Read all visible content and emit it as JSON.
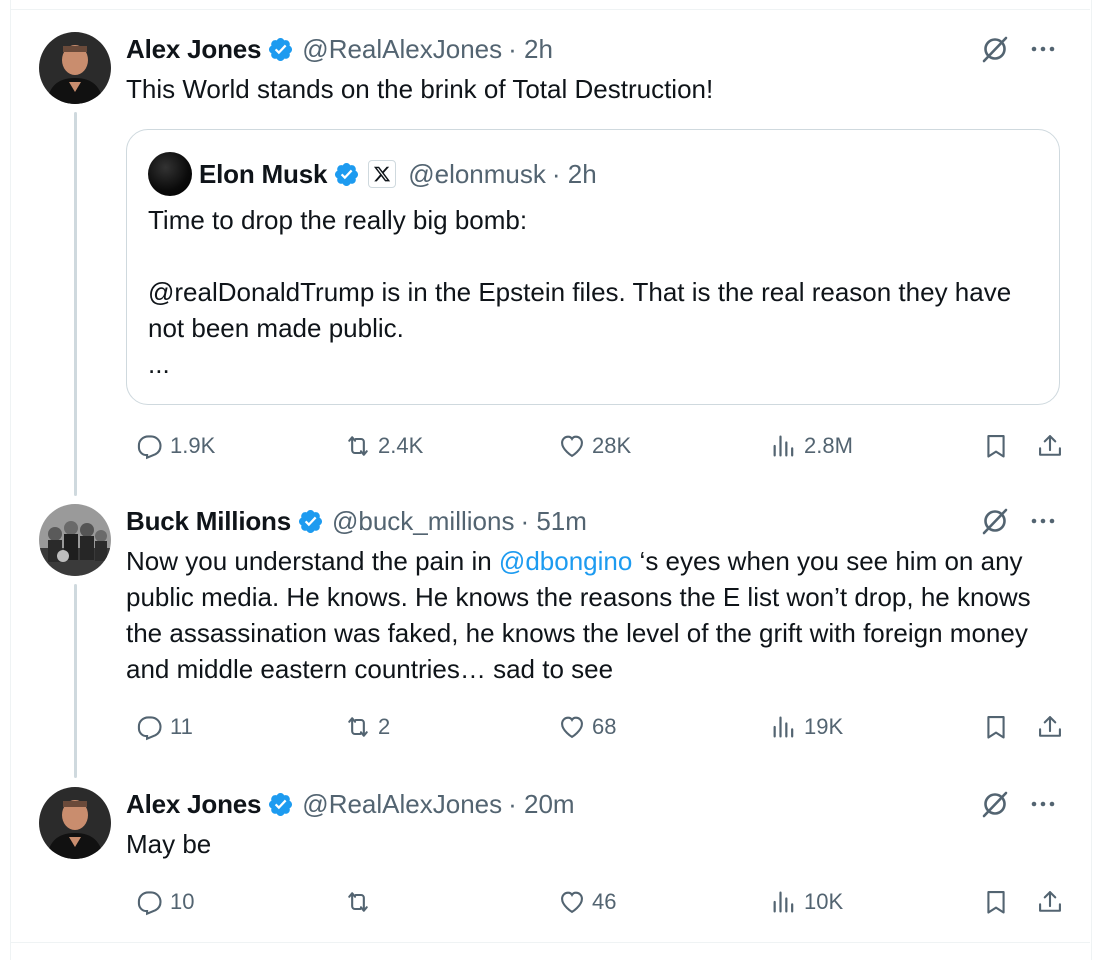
{
  "tweets": [
    {
      "name": "Alex Jones",
      "handle": "@RealAlexJones",
      "time": "· 2h",
      "text": "This World stands on the brink of Total Destruction!",
      "quote": {
        "name": "Elon Musk",
        "handle": "@elonmusk",
        "time": "· 2h",
        "line1": "Time to drop the really big bomb:",
        "line2": "@realDonaldTrump is in the Epstein files. That is the real reason they have not been made public.",
        "line3": "..."
      },
      "replies": "1.9K",
      "reposts": "2.4K",
      "likes": "28K",
      "views": "2.8M"
    },
    {
      "name": "Buck Millions",
      "handle": "@buck_millions",
      "time": "· 51m",
      "text_before": "Now you understand the pain in ",
      "mention": "@dbongino",
      "text_after": " ‘s eyes when you see him on any public media. He knows. He knows the reasons the E list won’t drop, he knows the assassination was faked, he knows the level of the grift with foreign money and middle eastern countries… sad to see",
      "replies": "11",
      "reposts": "2",
      "likes": "68",
      "views": "19K"
    },
    {
      "name": "Alex Jones",
      "handle": "@RealAlexJones",
      "time": "· 20m",
      "text": "May be",
      "replies": "10",
      "reposts": "",
      "likes": "46",
      "views": "10K"
    }
  ],
  "colors": {
    "accent": "#1d9bf0",
    "secondary": "#536471",
    "border": "#cfd9de",
    "verified": "#1d9bf0"
  },
  "icons": [
    "verified-badge-icon",
    "grok-icon",
    "more-icon",
    "reply-icon",
    "repost-icon",
    "like-icon",
    "views-icon",
    "bookmark-icon",
    "share-icon",
    "x-logo-icon"
  ]
}
